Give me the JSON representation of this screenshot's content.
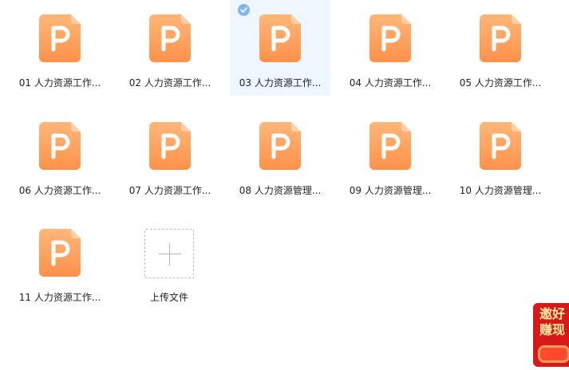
{
  "files": [
    {
      "name": "01 人力资源工作..."
    },
    {
      "name": "02 人力资源工作..."
    },
    {
      "name": "03 人力资源工作...",
      "selected": true
    },
    {
      "name": "04 人力资源工作..."
    },
    {
      "name": "05 人力资源工作..."
    },
    {
      "name": "06 人力资源工作..."
    },
    {
      "name": "07 人力资源工作..."
    },
    {
      "name": "08 人力资源管理..."
    },
    {
      "name": "09 人力资源管理..."
    },
    {
      "name": "10 人力资源管理..."
    },
    {
      "name": "11 人力资源工作..."
    }
  ],
  "upload": {
    "label": "上传文件"
  },
  "promo": {
    "line1": "邀好",
    "line2": "赚现"
  },
  "colors": {
    "file_icon_top": "#ffb77a",
    "file_icon_bottom": "#ff914a",
    "selected_bg": "#eef6ff",
    "check_bg": "#7db7f2",
    "promo_bg": "#d71919"
  },
  "icons": {
    "file": "ppt-file-icon",
    "upload": "plus-icon",
    "selected": "check-circle-icon"
  }
}
